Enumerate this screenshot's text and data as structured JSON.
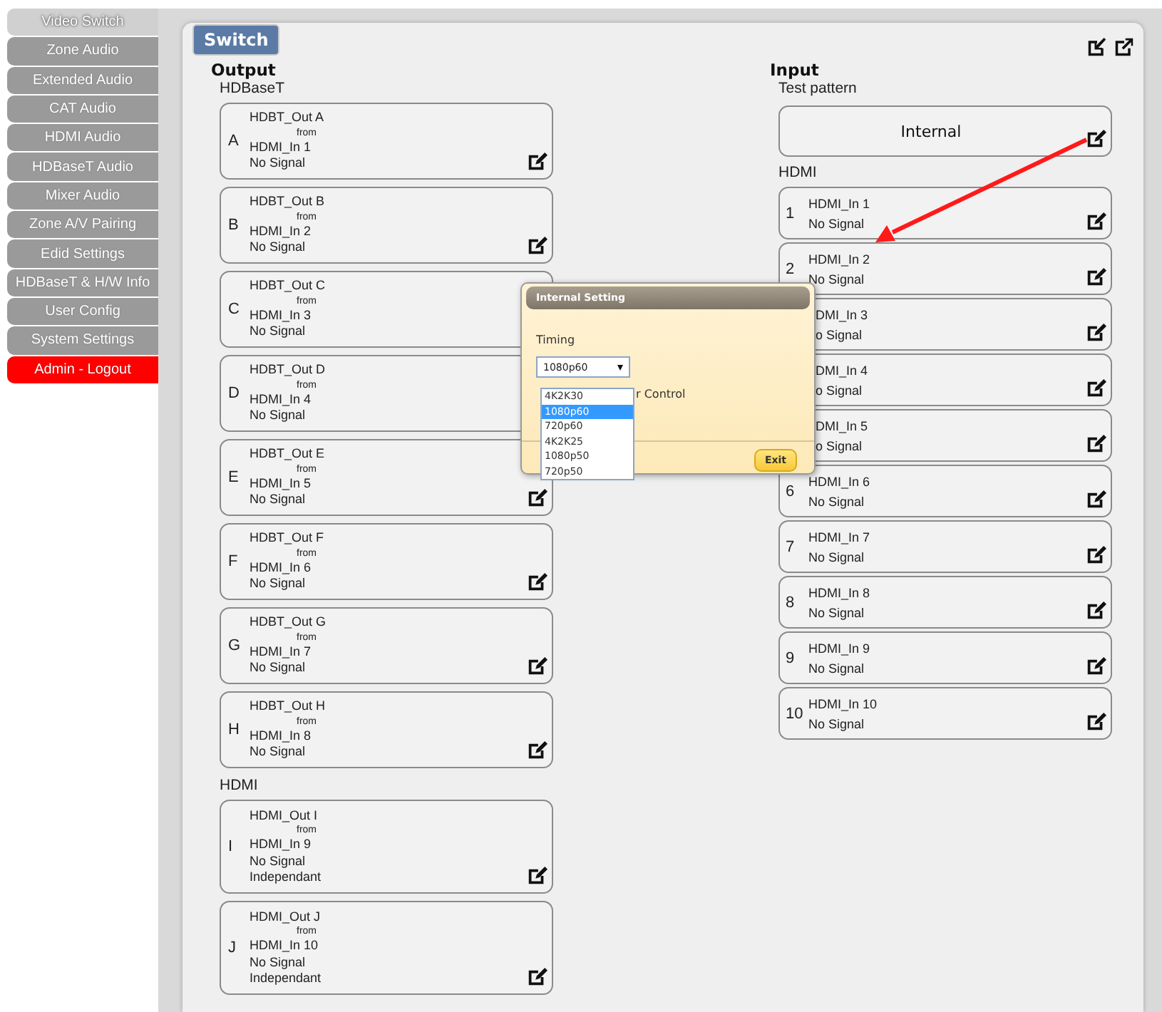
{
  "sidebar": {
    "items": [
      {
        "label": "Video Switch",
        "selected": true,
        "kind": "nav"
      },
      {
        "label": "Zone Audio",
        "selected": false,
        "kind": "nav"
      },
      {
        "label": "Extended Audio",
        "selected": false,
        "kind": "nav"
      },
      {
        "label": "CAT Audio",
        "selected": false,
        "kind": "nav"
      },
      {
        "label": "HDMI Audio",
        "selected": false,
        "kind": "nav"
      },
      {
        "label": "HDBaseT Audio",
        "selected": false,
        "kind": "nav"
      },
      {
        "label": "Mixer Audio",
        "selected": false,
        "kind": "nav"
      },
      {
        "label": "Zone A/V Pairing",
        "selected": false,
        "kind": "nav"
      },
      {
        "label": "Edid Settings",
        "selected": false,
        "kind": "nav"
      },
      {
        "label": "HDBaseT & H/W Info",
        "selected": false,
        "kind": "nav"
      },
      {
        "label": "User Config",
        "selected": false,
        "kind": "nav"
      },
      {
        "label": "System Settings",
        "selected": false,
        "kind": "nav"
      },
      {
        "label": "Admin - Logout",
        "selected": false,
        "kind": "logout"
      }
    ]
  },
  "panel": {
    "tab": "Switch",
    "output": {
      "heading": "Output",
      "groups": [
        {
          "label": "HDBaseT",
          "cards": [
            {
              "letter": "A",
              "name": "HDBT_Out A",
              "from": "from",
              "source": "HDMI_In 1",
              "status": "No Signal",
              "edit": true
            },
            {
              "letter": "B",
              "name": "HDBT_Out B",
              "from": "from",
              "source": "HDMI_In 2",
              "status": "No Signal",
              "edit": true
            },
            {
              "letter": "C",
              "name": "HDBT_Out C",
              "from": "from",
              "source": "HDMI_In 3",
              "status": "No Signal"
            },
            {
              "letter": "D",
              "name": "HDBT_Out D",
              "from": "from",
              "source": "HDMI_In 4",
              "status": "No Signal"
            },
            {
              "letter": "E",
              "name": "HDBT_Out E",
              "from": "from",
              "source": "HDMI_In 5",
              "status": "No Signal",
              "edit": true
            },
            {
              "letter": "F",
              "name": "HDBT_Out F",
              "from": "from",
              "source": "HDMI_In 6",
              "status": "No Signal",
              "edit": true
            },
            {
              "letter": "G",
              "name": "HDBT_Out G",
              "from": "from",
              "source": "HDMI_In 7",
              "status": "No Signal",
              "edit": true
            },
            {
              "letter": "H",
              "name": "HDBT_Out H",
              "from": "from",
              "source": "HDMI_In 8",
              "status": "No Signal",
              "edit": true
            }
          ]
        },
        {
          "label": "HDMI",
          "cards": [
            {
              "letter": "I",
              "name": "HDMI_Out I",
              "from": "from",
              "source": "HDMI_In 9",
              "status": "No Signal",
              "mode": "Independant",
              "edit": true
            },
            {
              "letter": "J",
              "name": "HDMI_Out J",
              "from": "from",
              "source": "HDMI_In 10",
              "status": "No Signal",
              "mode": "Independant",
              "edit": true
            }
          ]
        }
      ]
    },
    "input": {
      "heading": "Input",
      "test_pattern": {
        "label": "Test pattern",
        "value": "Internal"
      },
      "hdmi": {
        "label": "HDMI",
        "cards": [
          {
            "number": "1",
            "name": "HDMI_In 1",
            "status": "No Signal",
            "covered": false
          },
          {
            "number": "2",
            "name": "HDMI_In 2",
            "status": "No Signal",
            "covered": false
          },
          {
            "name": "DMI_In 3",
            "status": "o Signal",
            "covered": true
          },
          {
            "name": "DMI_In 4",
            "status": "o Signal",
            "covered": true
          },
          {
            "name": "DMI_In 5",
            "status": "o Signal",
            "covered": true
          },
          {
            "number": "6",
            "name": "HDMI_In 6",
            "status": "No Signal",
            "covered": false
          },
          {
            "number": "7",
            "name": "HDMI_In 7",
            "status": "No Signal",
            "covered": false
          },
          {
            "number": "8",
            "name": "HDMI_In 8",
            "status": "No Signal",
            "covered": false
          },
          {
            "number": "9",
            "name": "HDMI_In 9",
            "status": "No Signal",
            "covered": false
          },
          {
            "number": "10",
            "name": "HDMI_In 10",
            "status": "No Signal",
            "covered": false
          }
        ]
      }
    }
  },
  "dialog": {
    "title": "Internal Setting",
    "timing_label": "Timing",
    "select_value": "1080p60",
    "options": [
      {
        "label": "4K2K30",
        "selected": false
      },
      {
        "label": "1080p60",
        "selected": true
      },
      {
        "label": "720p60",
        "selected": false
      },
      {
        "label": "4K2K25",
        "selected": false
      },
      {
        "label": "1080p50",
        "selected": false
      },
      {
        "label": "720p50",
        "selected": false
      }
    ],
    "partial_label": "r Control",
    "exit": "Exit"
  }
}
